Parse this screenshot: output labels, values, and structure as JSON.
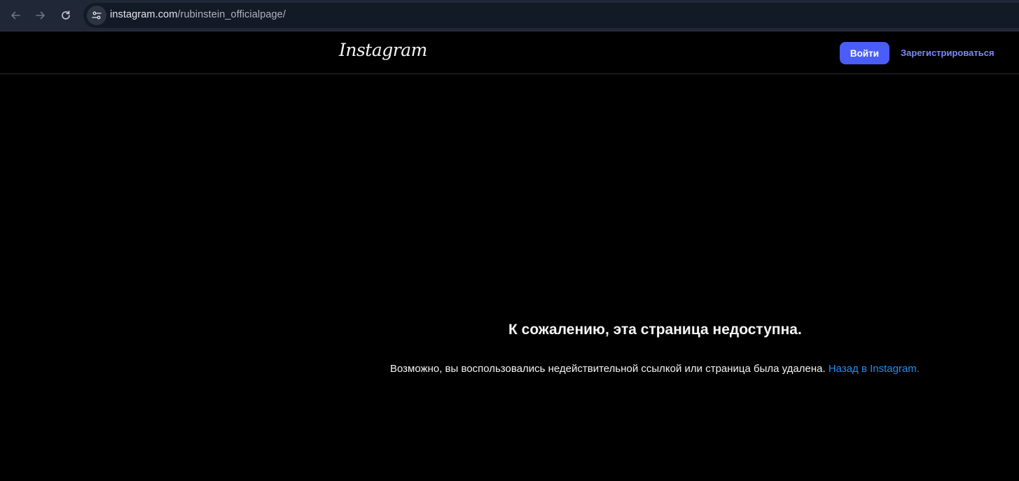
{
  "browser": {
    "url_host": "instagram.com",
    "url_path": "/rubinstein_officialpage/",
    "icons": {
      "back": "arrow-left-icon",
      "forward": "arrow-right-icon",
      "reload": "reload-icon",
      "site_info": "tune-icon"
    }
  },
  "header": {
    "logo": "Instagram",
    "login_label": "Войти",
    "signup_label": "Зарегистрироваться"
  },
  "error": {
    "title": "К сожалению, эта страница недоступна.",
    "description": "Возможно, вы воспользовались недействительной ссылкой или страница была удалена.",
    "back_link": "Назад в Instagram."
  },
  "colors": {
    "background": "#000000",
    "browser_bar": "#202837",
    "login_button": "#4a5df9",
    "signup_link": "#7b8aff",
    "back_link": "#1e8df5"
  }
}
